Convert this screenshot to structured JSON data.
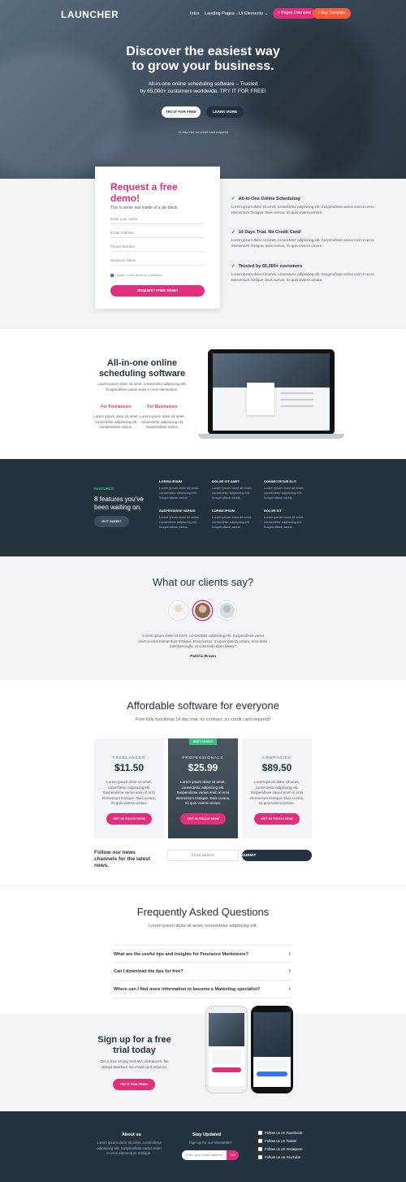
{
  "header": {
    "logo": "LAUNCHER",
    "nav": [
      "Intro",
      "Landing Pages",
      "UI Elements"
    ],
    "btn_pages": "Pages Overview",
    "btn_buy": "Buy Template"
  },
  "hero": {
    "title_1": "Discover the easiest way",
    "title_2": "to grow your business.",
    "sub_1": "All-in-one online scheduling software – Trusted",
    "sub_2": "by 65,000+ customers worldwide. TRY IT FOR FREE!",
    "btn_try": "TRY IT FOR FREE",
    "btn_learn": "LEARN MORE",
    "note": "14 day trial, no credit card required"
  },
  "demo": {
    "title": "Request a free demo!",
    "subtitle": "This is some text inside of a div block.",
    "fields": [
      "Enter your name",
      "Email Address",
      "Phone Number",
      "Business Name"
    ],
    "agree": "I agree to the terms & conditions",
    "submit": "REQUEST FREE DEMO"
  },
  "benefits": [
    {
      "title": "All-In-One Online Scheduling",
      "desc": "Lorem ipsum dolor sit amet, consectetur adipiscing elit. Suspendisse varius enim in eros elementum tristique. Duis cursus, mi quis viverra ornare."
    },
    {
      "title": "14 Days Trial. No Credit Card!",
      "desc": "Lorem ipsum dolor sit amet, consectetur adipiscing elit. Suspendisse varius enim in eros elementum tristique. Duis cursus, mi quis viverra ornare."
    },
    {
      "title": "Trusted by 65,000+ customers",
      "desc": "Lorem ipsum dolor sit amet, consectetur adipiscing elit. Suspendisse varius enim in eros elementum tristique. Duis cursus, mi quis viverra ornare."
    }
  ],
  "allinone": {
    "title": "All-in-one online scheduling software",
    "desc": "Lorem ipsum dolor sit amet, consectetur adipiscing elit. Suspendisse varius enim in eros elementum.",
    "col1_title": "For Freelancers",
    "col1_desc": "Lorem ipsum dolor sit amet, consectetur adipiscing elit. Suspendisse varius.",
    "col2_title": "For Businesses",
    "col2_desc": "Lorem ipsum dolor sit amet, consectetur adipiscing elit. Suspendisse varius."
  },
  "features": {
    "tag": "FEATURES",
    "title": "8 features you've been waiting on.",
    "btn": "IS IT GOOD?",
    "items": [
      {
        "title": "LOREM IPSUM",
        "desc": "Lorem ipsum dolor sit amet, consectetur adipiscing elit. Suspendisse varius."
      },
      {
        "title": "DOLOR SIT AMET",
        "desc": "Lorem ipsum dolor sit amet, consectetur adipiscing elit. Suspendisse varius."
      },
      {
        "title": "CONSECTETUR ELIT",
        "desc": "Lorem ipsum dolor sit amet, consectetur adipiscing elit. Suspendisse varius."
      },
      {
        "title": "SUSPENDISSE VARIUS",
        "desc": "Lorem ipsum dolor sit amet, consectetur adipiscing elit. Suspendisse varius."
      },
      {
        "title": "LOREM IPSUM",
        "desc": "Lorem ipsum dolor sit amet, consectetur adipiscing elit. Suspendisse varius."
      },
      {
        "title": "DOLOR SIT",
        "desc": "Lorem ipsum dolor sit amet, consectetur adipiscing elit. Suspendisse varius."
      }
    ]
  },
  "clients": {
    "title": "What our clients say?",
    "quote": "“Lorem ipsum dolor sit amet, consectetur adipiscing elit. Suspendisse varius enim in eros elementum tristique. Duis cursus, mi quis viverra ornare, eros dolor interdum nulla, ut commodo diam libero.”",
    "name": "Patricia Brown"
  },
  "pricing": {
    "title": "Affordable software for everyone",
    "sub": "Free fully functional 14 day trial, no contract, no credit card required!",
    "badge": "BEST CHOICE",
    "plans": [
      {
        "name": "FREELANCER",
        "price": "$11.50",
        "desc": "Lorem ipsum dolor sit amet, consectetur adipiscing elit. Suspendisse varius enim in eros elementum tristique. Duis cursus, mi quis viverra ornare.",
        "btn": "GET IN TOUCH NOW"
      },
      {
        "name": "PROFESSIONALS",
        "price": "$25.99",
        "desc": "Lorem ipsum dolor sit amet, consectetur adipiscing elit. Suspendisse varius enim in eros elementum tristique. Duis cursus, mi quis viverra ornare.",
        "btn": "GET IN TOUCH NOW"
      },
      {
        "name": "COMPANIES",
        "price": "$89.50",
        "desc": "Lorem ipsum dolor sit amet, consectetur adipiscing elit. Suspendisse varius enim in eros elementum tristique. Duis cursus, mi quis viverra ornare.",
        "btn": "GET IN TOUCH NOW"
      }
    ],
    "news_title": "Follow our news channels for the latest news.",
    "news_placeholder": "Email address",
    "news_btn": "SUBMIT"
  },
  "faq": {
    "title": "Frequently Asked Questions",
    "sub": "Lorem ipsum dolor sit amet, consectetur adipiscing elit.",
    "questions": [
      "What are the useful tips and insights for Freelance Marketeers?",
      "Can I download the tips for free?",
      "Where can I find more information to become a Marketing specialist?"
    ]
  },
  "signup": {
    "title": "Sign up for a free trial today",
    "desc": "Get a free 14 day trial with all features. No strings attached. No credit card required.",
    "btn": "TRY IT FOR FREE!"
  },
  "footer": {
    "about_title": "About us",
    "about_desc": "Lorem ipsum dolor sit amet, consectetur adipiscing elit. Suspendisse varius enim in eros elementum tristique.",
    "stay_title": "Stay Updated",
    "stay_desc": "Sign up for our newsletter!",
    "email_placeholder": "Enter your email address",
    "go": "GO!",
    "social": [
      "Follow us on Facebook",
      "Follow us on Twitter",
      "Follow us on Instagram",
      "Follow us on YouTube"
    ]
  },
  "colors": {
    "accent": "#e22f7c",
    "dark": "#233340",
    "green": "#3cc07e",
    "orange": "#ff5a36"
  }
}
